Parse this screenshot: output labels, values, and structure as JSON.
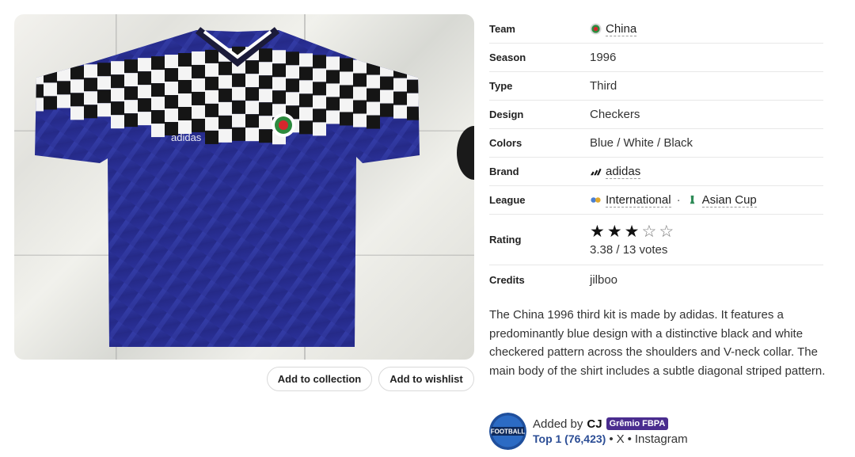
{
  "product": {
    "image_alt": "China 1996 third shirt photo",
    "adidas_wordmark": "adidas",
    "add_to_collection": "Add to collection",
    "add_to_wishlist": "Add to wishlist"
  },
  "details": {
    "team_label": "Team",
    "team_value": "China",
    "season_label": "Season",
    "season_value": "1996",
    "type_label": "Type",
    "type_value": "Third",
    "design_label": "Design",
    "design_value": "Checkers",
    "colors_label": "Colors",
    "colors_value": "Blue / White / Black",
    "brand_label": "Brand",
    "brand_value": "adidas",
    "league_label": "League",
    "league_value_1": "International",
    "league_separator": "·",
    "league_value_2": "Asian Cup",
    "rating_label": "Rating",
    "rating_stars": 3,
    "rating_max": 5,
    "rating_value": "3.38 / 13 votes",
    "credits_label": "Credits",
    "credits_value": "jilboo"
  },
  "description": "The China 1996 third kit is made by adidas. It features a predominantly blue design with a distinctive black and white checkered pattern across the shoulders and V-neck collar. The main body of the shirt includes a subtle diagonal striped pattern.",
  "added_by": {
    "prefix": "Added by",
    "user": "CJ",
    "team_badge": "Grêmio FBPA",
    "rank": "Top 1 (76,423)",
    "bullet": "•",
    "social_x": "X",
    "social_instagram": "Instagram"
  },
  "colors": {
    "shirt_blue": "#2a2f8f",
    "badge_purple": "#4a2d8f",
    "rank_blue": "#2b4d95"
  }
}
